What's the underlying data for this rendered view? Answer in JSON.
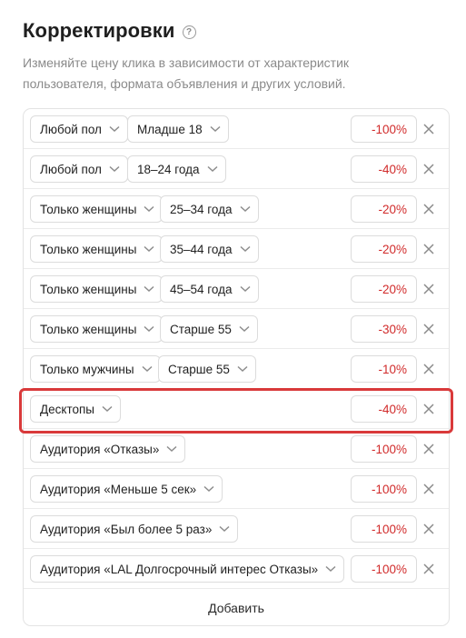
{
  "header": {
    "title": "Корректировки",
    "help_icon": "question-circle-icon",
    "subtitle": "Изменяйте цену клика в зависимости от характеристик пользователя, формата объявления и других условий."
  },
  "colors": {
    "negative_value": "#d12b2b",
    "highlight_border": "#d9393a"
  },
  "rows": [
    {
      "sel1": "Любой пол",
      "sel2": "Младше 18",
      "value": "-100%"
    },
    {
      "sel1": "Любой пол",
      "sel2": "18–24 года",
      "value": "-40%"
    },
    {
      "sel1": "Только женщины",
      "sel2": "25–34 года",
      "value": "-20%"
    },
    {
      "sel1": "Только женщины",
      "sel2": "35–44 года",
      "value": "-20%"
    },
    {
      "sel1": "Только женщины",
      "sel2": "45–54 года",
      "value": "-20%"
    },
    {
      "sel1": "Только женщины",
      "sel2": "Старше 55",
      "value": "-30%"
    },
    {
      "sel1": "Только мужчины",
      "sel2": "Старше 55",
      "value": "-10%"
    },
    {
      "sel1": "Десктопы",
      "value": "-40%",
      "highlighted": true
    },
    {
      "sel1": "Аудитория «Отказы»",
      "value": "-100%"
    },
    {
      "sel1": "Аудитория «Меньше 5 сек»",
      "value": "-100%"
    },
    {
      "sel1": "Аудитория «Был более 5 раз»",
      "value": "-100%"
    },
    {
      "sel1": "Аудитория «LAL Долгосрочный интерес Отказы»",
      "value": "-100%"
    }
  ],
  "add_label": "Добавить"
}
